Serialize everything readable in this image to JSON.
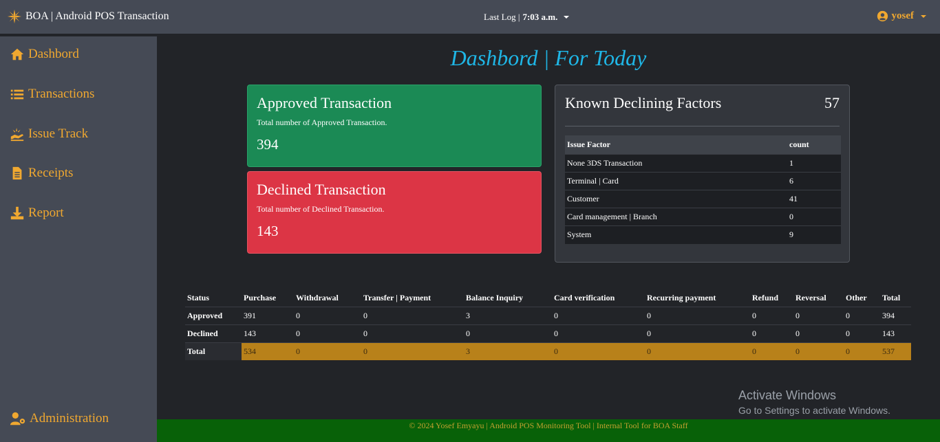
{
  "app": {
    "title": "BOA | Android POS Transaction"
  },
  "header": {
    "last_log_label": "Last Log |",
    "last_log_time": "7:03 a.m.",
    "user": "yosef"
  },
  "sidebar": {
    "items": [
      {
        "label": "Dashbord",
        "icon": "home-icon"
      },
      {
        "label": "Transactions",
        "icon": "list-icon"
      },
      {
        "label": "Issue Track",
        "icon": "hand-sparkle-icon"
      },
      {
        "label": "Receipts",
        "icon": "receipt-icon"
      },
      {
        "label": "Report",
        "icon": "download-icon"
      }
    ],
    "admin": {
      "label": "Administration",
      "icon": "user-key-icon"
    }
  },
  "page": {
    "title": "Dashbord | For Today"
  },
  "approved_card": {
    "title": "Approved Transaction",
    "subtitle": "Total number of Approved Transaction.",
    "count": "394"
  },
  "declined_card": {
    "title": "Declined Transaction",
    "subtitle": "Total number of Declined Transaction.",
    "count": "143"
  },
  "factors": {
    "title": "Known Declining Factors",
    "total": "57",
    "columns": [
      "Issue Factor",
      "count"
    ],
    "rows": [
      [
        "None 3DS Transaction",
        "1"
      ],
      [
        "Terminal | Card",
        "6"
      ],
      [
        "Customer",
        "41"
      ],
      [
        "Card management | Branch",
        "0"
      ],
      [
        "System",
        "9"
      ]
    ]
  },
  "summary": {
    "columns": [
      "Status",
      "Purchase",
      "Withdrawal",
      "Transfer | Payment",
      "Balance Inquiry",
      "Card verification",
      "Recurring payment",
      "Refund",
      "Reversal",
      "Other",
      "Total"
    ],
    "rows": [
      [
        "Approved",
        "391",
        "0",
        "0",
        "3",
        "0",
        "0",
        "0",
        "0",
        "0",
        "394"
      ],
      [
        "Declined",
        "143",
        "0",
        "0",
        "0",
        "0",
        "0",
        "0",
        "0",
        "0",
        "143"
      ],
      [
        "Total",
        "534",
        "0",
        "0",
        "3",
        "0",
        "0",
        "0",
        "0",
        "0",
        "537"
      ]
    ]
  },
  "watermark": {
    "line1": "Activate Windows",
    "line2": "Go to Settings to activate Windows."
  },
  "footer": {
    "text": "© 2024 Yosef Emyayu | Android POS Monitoring Tool | Internal Tool for BOA Staff"
  },
  "colors": {
    "accent": "#f0a830",
    "title_blue": "#1fb6e6",
    "approved": "#1b8a55",
    "declined": "#dc3545",
    "total_row": "#b8811a",
    "footer": "#086108"
  }
}
